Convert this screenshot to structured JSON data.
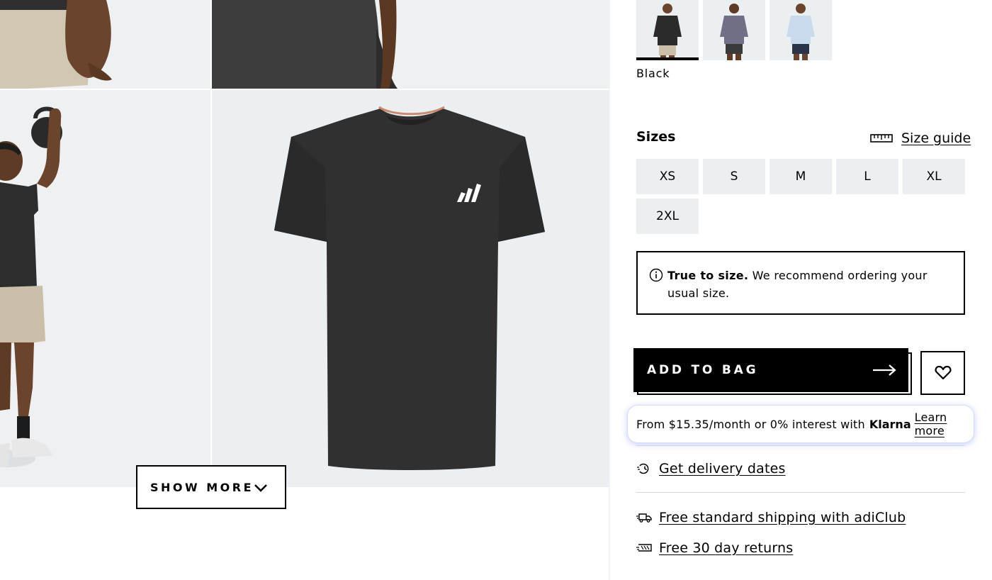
{
  "gallery": {
    "show_more_label": "SHOW MORE"
  },
  "colors": {
    "selected_name": "Black",
    "swatches": [
      {
        "name": "Black",
        "shirt": "#2b2b2b",
        "selected": true
      },
      {
        "name": "Grey",
        "shirt": "#6f6f86",
        "selected": false
      },
      {
        "name": "Light blue",
        "shirt": "#c8daec",
        "selected": false
      }
    ]
  },
  "sizes": {
    "title": "Sizes",
    "guide_label": "Size guide",
    "options": [
      "XS",
      "S",
      "M",
      "L",
      "XL",
      "2XL"
    ]
  },
  "fit": {
    "bold": "True to size.",
    "text": " We recommend ordering your usual size."
  },
  "cta": {
    "add_to_bag": "ADD TO BAG"
  },
  "klarna": {
    "text": "From $15.35/month or 0% interest with",
    "brand": "Klarna",
    "link": "Learn more"
  },
  "delivery": {
    "dates_link": "Get delivery dates",
    "shipping_link": "Free standard shipping with adiClub",
    "returns_link": "Free 30 day returns"
  }
}
